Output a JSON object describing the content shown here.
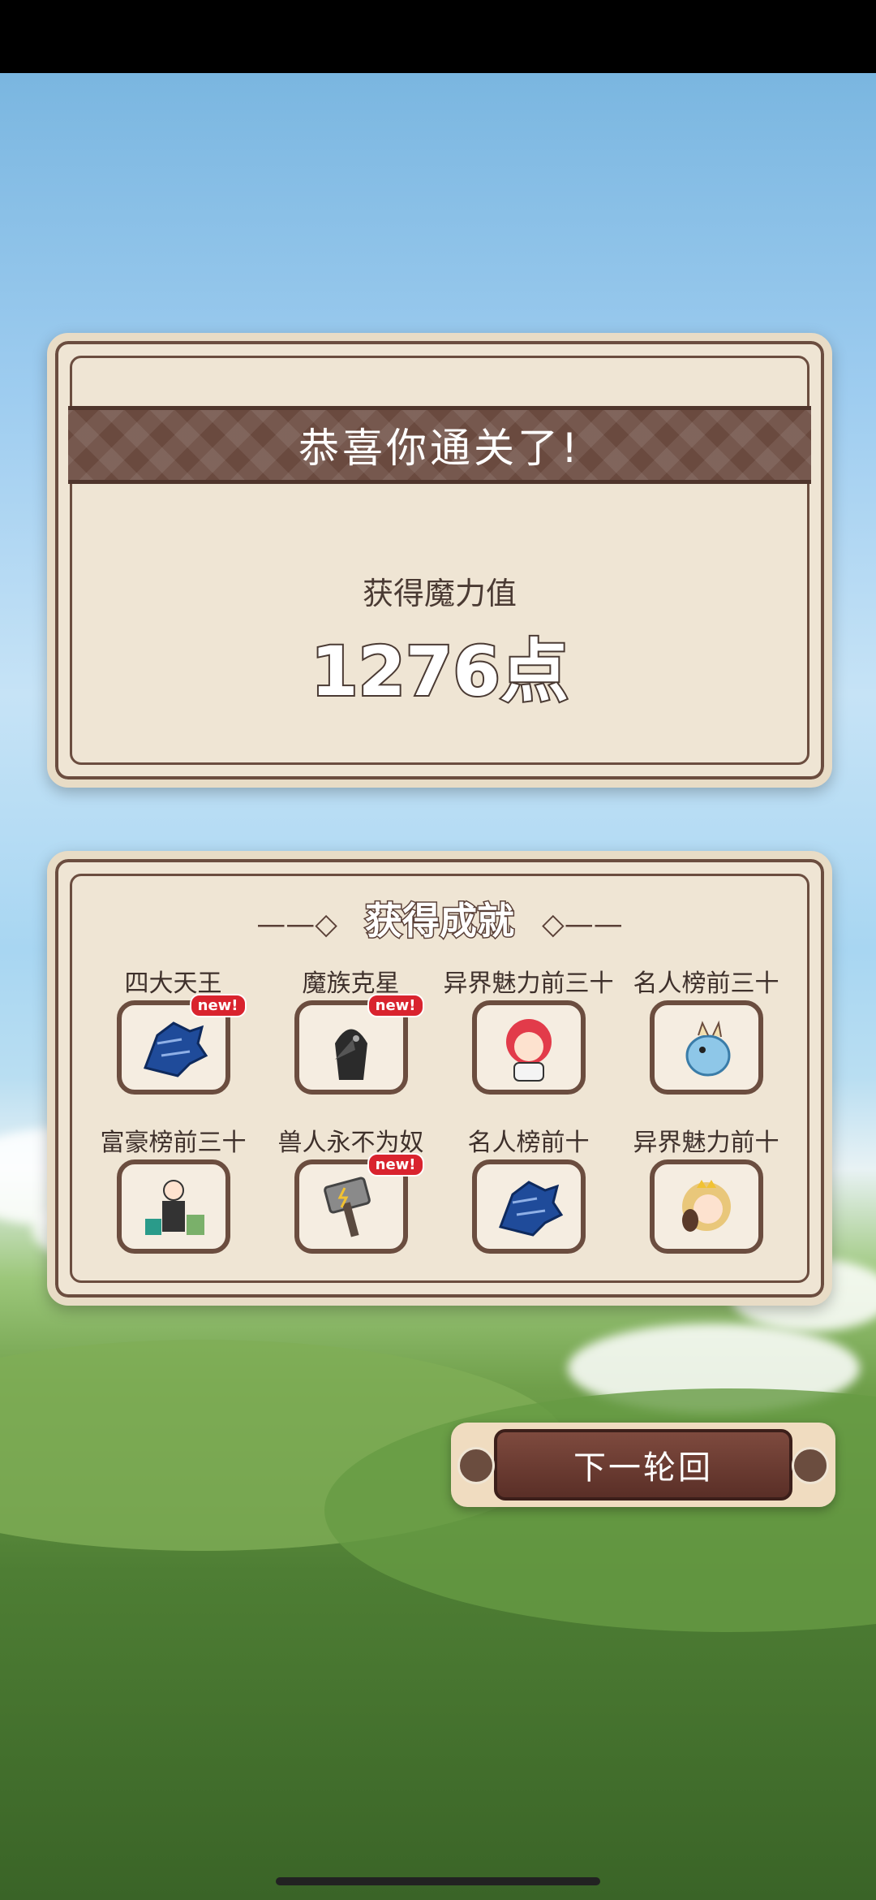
{
  "result_panel": {
    "title": "恭喜你通关了!",
    "mp_label": "获得魔力值",
    "mp_value": "1276点"
  },
  "achievements": {
    "title": "获得成就",
    "items": [
      {
        "name": "四大天王",
        "icon": "blue-dragon-icon",
        "new": true
      },
      {
        "name": "魔族克星",
        "icon": "plague-doctor-icon",
        "new": true
      },
      {
        "name": "异界魅力前三十",
        "icon": "red-hair-girl-icon",
        "new": false
      },
      {
        "name": "名人榜前三十",
        "icon": "blue-dragon-cub-icon",
        "new": false
      },
      {
        "name": "富豪榜前三十",
        "icon": "rich-man-icon",
        "new": false
      },
      {
        "name": "兽人永不为奴",
        "icon": "hammer-icon",
        "new": true
      },
      {
        "name": "名人榜前十",
        "icon": "blue-dragon-icon",
        "new": false
      },
      {
        "name": "异界魅力前十",
        "icon": "princess-icon",
        "new": false
      }
    ],
    "new_badge": "new!"
  },
  "next_button": {
    "label": "下一轮回"
  }
}
